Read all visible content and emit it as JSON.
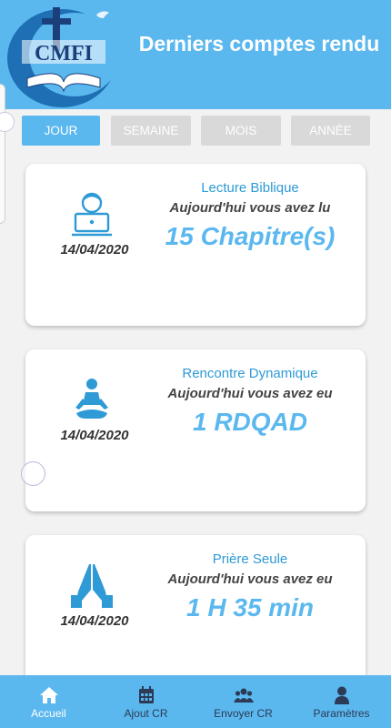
{
  "header": {
    "title": "Derniers comptes rendu",
    "logo_text": "CMFI"
  },
  "tabs": [
    {
      "label": "JOUR",
      "active": true
    },
    {
      "label": "SEMAINE",
      "active": false
    },
    {
      "label": "MOIS",
      "active": false
    },
    {
      "label": "ANNÉE",
      "active": false
    }
  ],
  "cards": [
    {
      "icon": "reading-person-icon",
      "date": "14/04/2020",
      "title": "Lecture Biblique",
      "subtitle": "Aujourd'hui vous avez lu",
      "value": "15 Chapitre(s)"
    },
    {
      "icon": "meditation-icon",
      "date": "14/04/2020",
      "title": "Rencontre Dynamique",
      "subtitle": "Aujourd'hui vous avez eu",
      "value": "1 RDQAD"
    },
    {
      "icon": "praying-hands-icon",
      "date": "14/04/2020",
      "title": "Prière Seule",
      "subtitle": "Aujourd'hui vous avez eu",
      "value": "1 H 35 min"
    }
  ],
  "bottom_nav": [
    {
      "label": "Accueil",
      "icon": "home-icon",
      "active": true
    },
    {
      "label": "Ajout CR",
      "icon": "calendar-icon",
      "active": false
    },
    {
      "label": "Envoyer CR",
      "icon": "group-icon",
      "active": false
    },
    {
      "label": "Paramètres",
      "icon": "user-icon",
      "active": false
    }
  ],
  "colors": {
    "primary": "#5bb8ef",
    "tab_inactive": "#d9d9d9",
    "title_text": "#2e9ad6"
  }
}
